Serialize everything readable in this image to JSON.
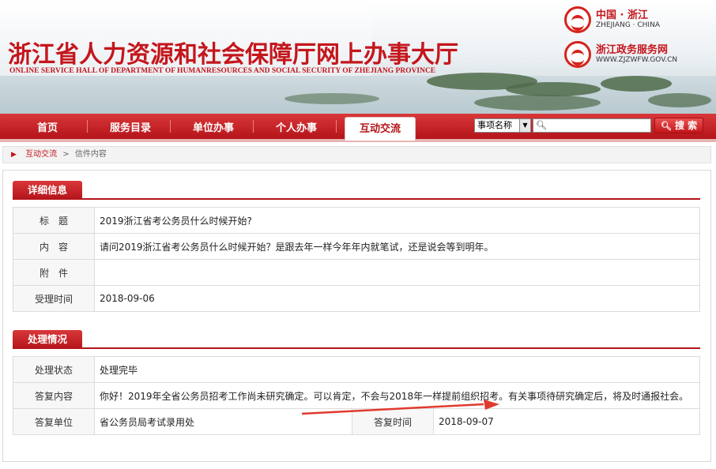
{
  "header": {
    "site_title": "浙江省人力资源和社会保障厅网上办事大厅",
    "site_subtitle": "ONLINE SERVICE HALL OF DEPARTMENT OF HUMANRESOURCES AND SOCIAL SECURITY OF ZHEJIANG PROVINCE",
    "logo_top_cn": "中国 · 浙江",
    "logo_top_en": "ZHEJIANG · CHINA",
    "logo_bottom_cn": "浙江政务服务网",
    "logo_bottom_en": "WWW.ZJZWFW.GOV.CN"
  },
  "nav": {
    "items": [
      "首页",
      "服务目录",
      "单位办事",
      "个人办事",
      "互动交流"
    ],
    "active": "互动交流"
  },
  "search": {
    "select_value": "事项名称",
    "button_label": "搜 索",
    "search_icon": "magnifier-icon"
  },
  "breadcrumb": {
    "link": "互动交流",
    "separator": ">",
    "current": "信件内容"
  },
  "detail": {
    "section_title": "详细信息",
    "rows": [
      {
        "label": "标　题",
        "value": "2019浙江省考公务员什么时候开始?"
      },
      {
        "label": "内　容",
        "value": "请问2019浙江省考公务员什么时候开始？是跟去年一样今年年内就笔试，还是说会等到明年。"
      },
      {
        "label": "附　件",
        "value": ""
      },
      {
        "label": "受理时间",
        "value": "2018-09-06"
      }
    ]
  },
  "processing": {
    "section_title": "处理情况",
    "status_label": "处理状态",
    "status_value": "处理完毕",
    "reply_label": "答复内容",
    "reply_value": "你好！2019年全省公务员招考工作尚未研究确定。可以肯定，不会与2018年一样提前组织招考。有关事项待研究确定后，将及时通报社会。",
    "unit_label": "答复单位",
    "unit_value": "省公务员局考试录用处",
    "time_label": "答复时间",
    "time_value": "2018-09-07"
  },
  "colors": {
    "brand_red": "#c4161c",
    "annotation_arrow": "#e03a2f"
  }
}
